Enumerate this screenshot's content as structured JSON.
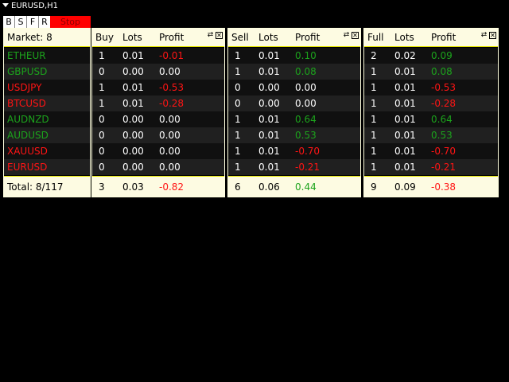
{
  "window": {
    "title": "EURUSD,H1"
  },
  "toolbar": {
    "b_label": "B",
    "s_label": "S",
    "f_label": "F",
    "r_label": "R",
    "stop_label": "Stop"
  },
  "market_panel": {
    "header": "Market: 8",
    "symbols": [
      {
        "name": "ETHEUR",
        "color": "green"
      },
      {
        "name": "GBPUSD",
        "color": "green"
      },
      {
        "name": "USDJPY",
        "color": "red"
      },
      {
        "name": "BTCUSD",
        "color": "red"
      },
      {
        "name": "AUDNZD",
        "color": "green"
      },
      {
        "name": "AUDUSD",
        "color": "green"
      },
      {
        "name": "XAUUSD",
        "color": "red"
      },
      {
        "name": "EURUSD",
        "color": "red"
      }
    ],
    "footer": "Total: 8/117"
  },
  "buy_panel": {
    "headers": [
      "Buy",
      "Lots",
      "Profit"
    ],
    "rows": [
      [
        "1",
        "0.01",
        "-0.01",
        "red"
      ],
      [
        "0",
        "0.00",
        "0.00",
        "white"
      ],
      [
        "1",
        "0.01",
        "-0.53",
        "red"
      ],
      [
        "1",
        "0.01",
        "-0.28",
        "red"
      ],
      [
        "0",
        "0.00",
        "0.00",
        "white"
      ],
      [
        "0",
        "0.00",
        "0.00",
        "white"
      ],
      [
        "0",
        "0.00",
        "0.00",
        "white"
      ],
      [
        "0",
        "0.00",
        "0.00",
        "white"
      ]
    ],
    "footer": [
      "3",
      "0.03",
      "-0.82",
      "red"
    ]
  },
  "sell_panel": {
    "headers": [
      "Sell",
      "Lots",
      "Profit"
    ],
    "rows": [
      [
        "1",
        "0.01",
        "0.10",
        "green"
      ],
      [
        "1",
        "0.01",
        "0.08",
        "green"
      ],
      [
        "0",
        "0.00",
        "0.00",
        "white"
      ],
      [
        "0",
        "0.00",
        "0.00",
        "white"
      ],
      [
        "1",
        "0.01",
        "0.64",
        "green"
      ],
      [
        "1",
        "0.01",
        "0.53",
        "green"
      ],
      [
        "1",
        "0.01",
        "-0.70",
        "red"
      ],
      [
        "1",
        "0.01",
        "-0.21",
        "red"
      ]
    ],
    "footer": [
      "6",
      "0.06",
      "0.44",
      "green"
    ]
  },
  "full_panel": {
    "headers": [
      "Full",
      "Lots",
      "Profit"
    ],
    "rows": [
      [
        "2",
        "0.02",
        "0.09",
        "green"
      ],
      [
        "1",
        "0.01",
        "0.08",
        "green"
      ],
      [
        "1",
        "0.01",
        "-0.53",
        "red"
      ],
      [
        "1",
        "0.01",
        "-0.28",
        "red"
      ],
      [
        "1",
        "0.01",
        "0.64",
        "green"
      ],
      [
        "1",
        "0.01",
        "0.53",
        "green"
      ],
      [
        "1",
        "0.01",
        "-0.70",
        "red"
      ],
      [
        "1",
        "0.01",
        "-0.21",
        "red"
      ]
    ],
    "footer": [
      "9",
      "0.09",
      "-0.38",
      "red"
    ]
  },
  "icons": {
    "collapse": "collapse-icon",
    "close": "close-icon"
  },
  "colors": {
    "green": "#1ca31c",
    "red": "#ff1414",
    "white": "#ffffff",
    "header_bg": "#fdfbe2",
    "stop_bg": "#ff0000",
    "divider": "#e3e300"
  }
}
